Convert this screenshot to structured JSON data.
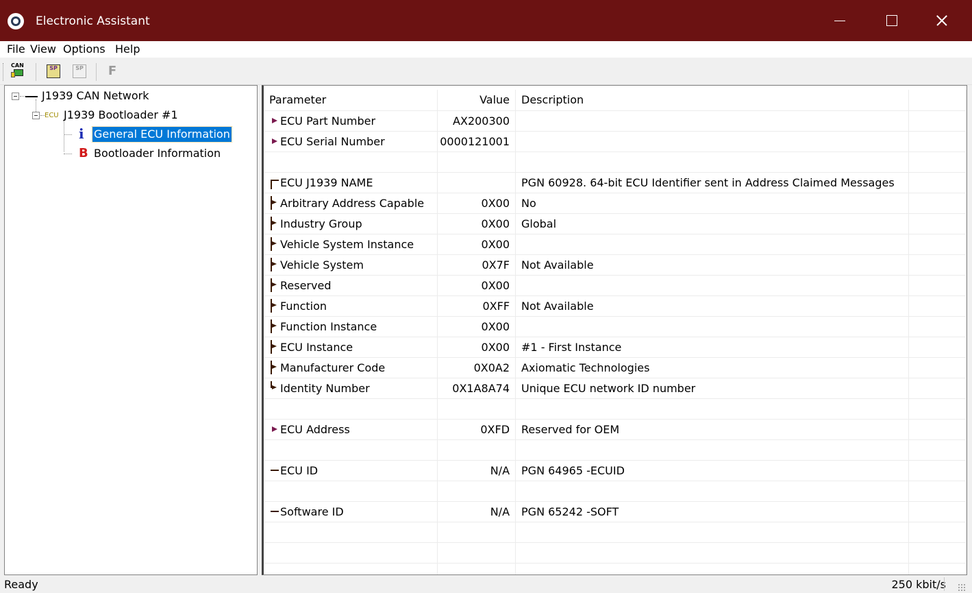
{
  "window": {
    "title": "Electronic Assistant",
    "icon": "axiomatic-logo-icon",
    "accent_color": "#6b1212"
  },
  "menu": {
    "items": [
      "File",
      "View",
      "Options",
      "Help"
    ]
  },
  "toolbar": {
    "buttons": [
      {
        "name": "can-connect",
        "label": "CAN"
      },
      {
        "name": "setpoint-file",
        "label": "SP"
      },
      {
        "name": "setpoint-disabled",
        "label": "SP"
      },
      {
        "name": "flash",
        "label": "F"
      }
    ]
  },
  "tree": {
    "network": "J1939 CAN Network",
    "ecu_tag": "ECU",
    "device": "J1939 Bootloader #1",
    "items": [
      {
        "icon": "i",
        "label": "General ECU Information",
        "selected": true
      },
      {
        "icon": "B",
        "label": "Bootloader Information",
        "selected": false
      }
    ]
  },
  "grid": {
    "headers": {
      "parameter": "Parameter",
      "value": "Value",
      "description": "Description"
    },
    "rows": [
      {
        "marker": "arrow",
        "parameter": "ECU Part Number",
        "value": "AX200300",
        "description": ""
      },
      {
        "marker": "arrow",
        "parameter": "ECU Serial Number",
        "value": "0000121001",
        "description": ""
      },
      {
        "marker": "",
        "parameter": "",
        "value": "",
        "description": ""
      },
      {
        "marker": "top",
        "parameter": "ECU J1939 NAME",
        "value": "",
        "description": "PGN 60928. 64-bit ECU Identifier sent in Address Claimed Messages"
      },
      {
        "marker": "mid",
        "parameter": "Arbitrary Address Capable",
        "value": "0X00",
        "description": "No"
      },
      {
        "marker": "mid",
        "parameter": "Industry Group",
        "value": "0X00",
        "description": "Global"
      },
      {
        "marker": "mid",
        "parameter": "Vehicle System Instance",
        "value": "0X00",
        "description": ""
      },
      {
        "marker": "mid",
        "parameter": "Vehicle System",
        "value": "0X7F",
        "description": "Not Available"
      },
      {
        "marker": "mid",
        "parameter": "Reserved",
        "value": "0X00",
        "description": ""
      },
      {
        "marker": "mid",
        "parameter": "Function",
        "value": "0XFF",
        "description": "Not Available"
      },
      {
        "marker": "mid",
        "parameter": "Function Instance",
        "value": "0X00",
        "description": ""
      },
      {
        "marker": "mid",
        "parameter": "ECU Instance",
        "value": "0X00",
        "description": "#1 - First Instance"
      },
      {
        "marker": "mid",
        "parameter": "Manufacturer Code",
        "value": "0X0A2",
        "description": "Axiomatic Technologies"
      },
      {
        "marker": "end",
        "parameter": "Identity Number",
        "value": "0X1A8A74",
        "description": "Unique ECU network ID number"
      },
      {
        "marker": "",
        "parameter": "",
        "value": "",
        "description": ""
      },
      {
        "marker": "arrow",
        "parameter": "ECU Address",
        "value": "0XFD",
        "description": "Reserved for OEM"
      },
      {
        "marker": "",
        "parameter": "",
        "value": "",
        "description": ""
      },
      {
        "marker": "dash",
        "parameter": "ECU ID",
        "value": "N/A",
        "description": "PGN 64965   -ECUID"
      },
      {
        "marker": "",
        "parameter": "",
        "value": "",
        "description": ""
      },
      {
        "marker": "dash",
        "parameter": "Software ID",
        "value": "N/A",
        "description": "PGN 65242   -SOFT"
      },
      {
        "marker": "",
        "parameter": "",
        "value": "",
        "description": ""
      },
      {
        "marker": "",
        "parameter": "",
        "value": "",
        "description": ""
      },
      {
        "marker": "",
        "parameter": "",
        "value": "",
        "description": ""
      }
    ]
  },
  "status": {
    "left": "Ready",
    "right": "250 kbit/s"
  }
}
